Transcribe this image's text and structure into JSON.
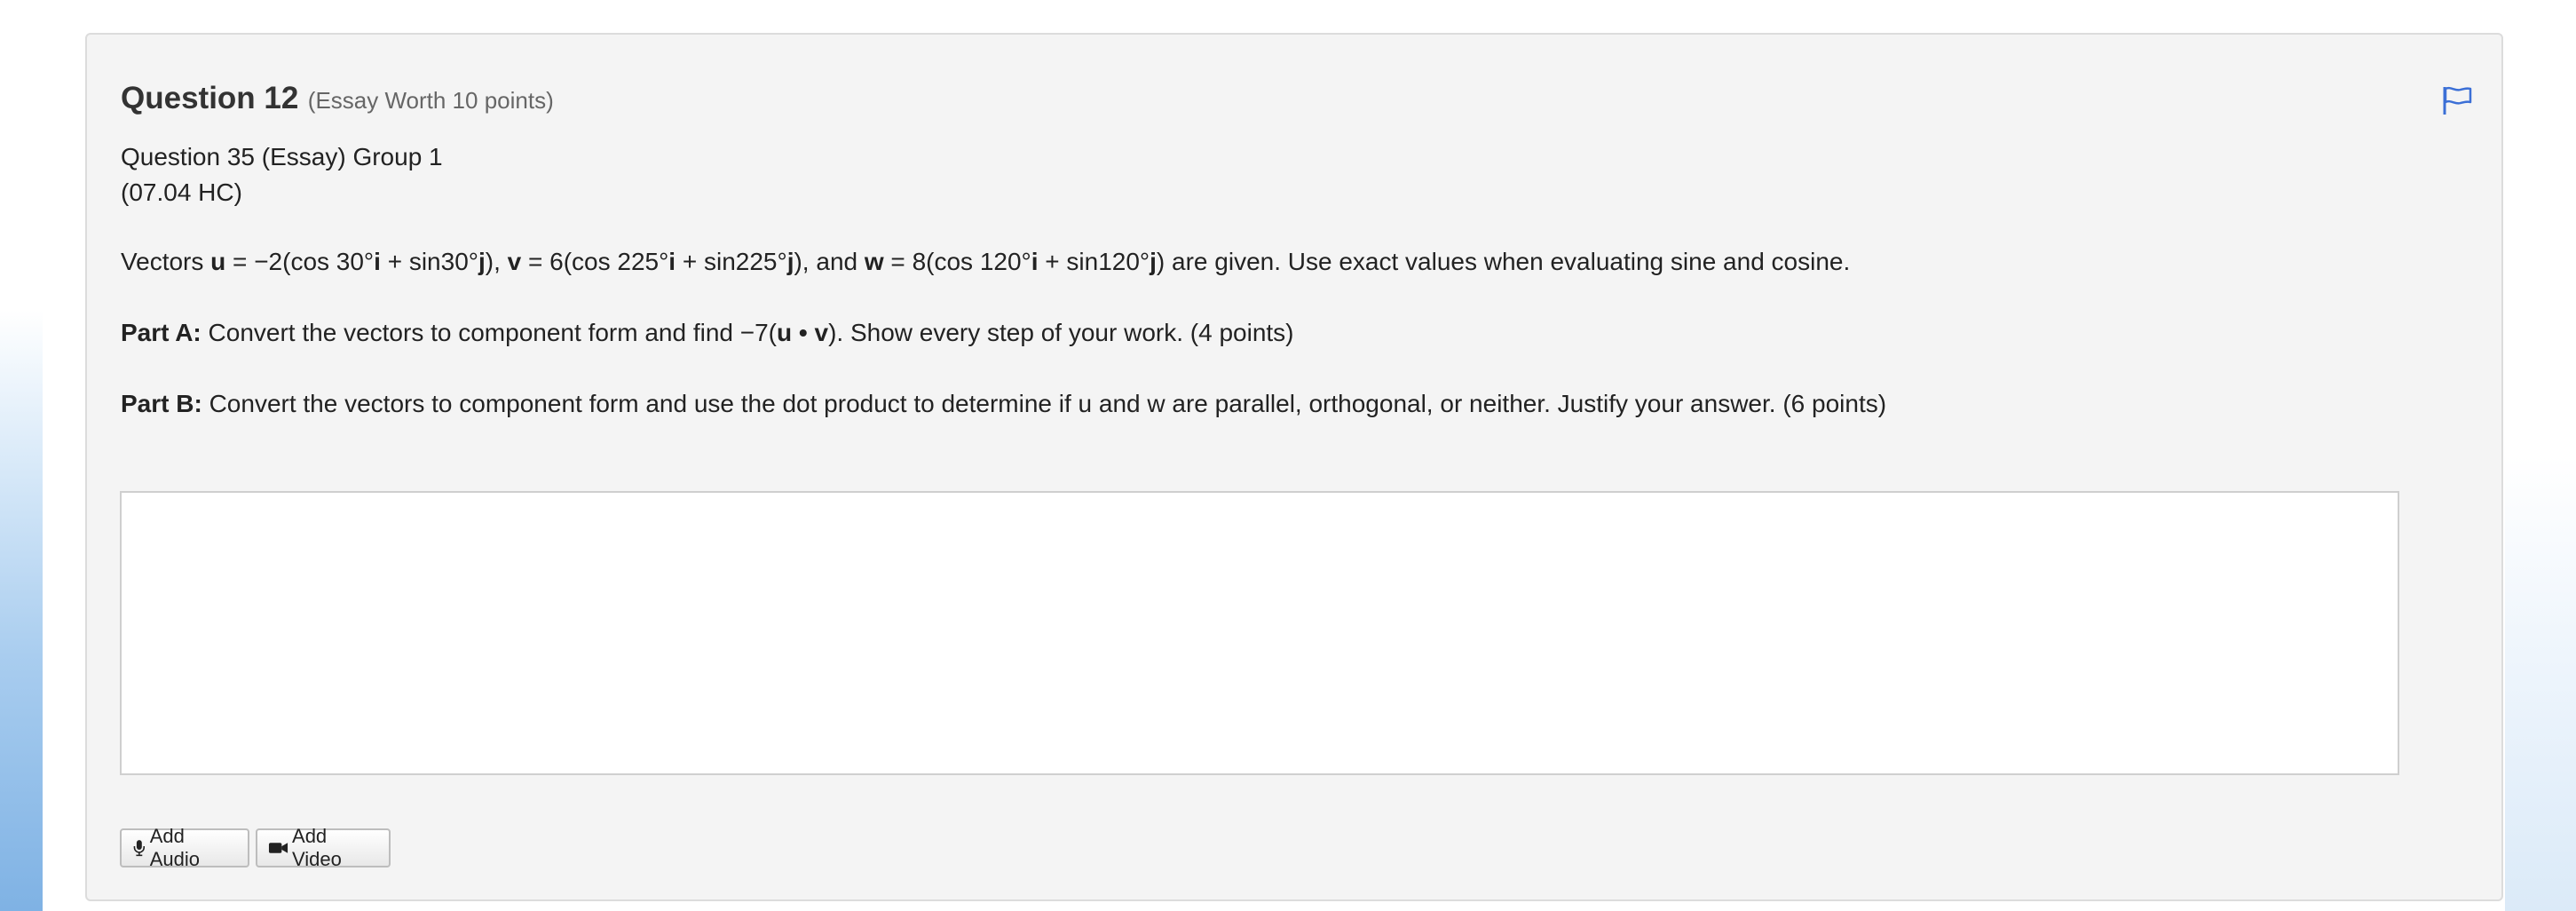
{
  "question": {
    "title": "Question 12",
    "worth": "(Essay Worth 10 points)",
    "group_line": "Question 35 (Essay) Group 1",
    "code_line": "(07.04 HC)",
    "prompt": {
      "p1": "Vectors ",
      "u": "u",
      "p2": " = −2(cos 30°",
      "i1": "i",
      "p3": " + sin30°",
      "j1": "j",
      "p4": "), ",
      "v": "v",
      "p5": " = 6(cos 225°",
      "i2": "i",
      "p6": " + sin225°",
      "j2": "j",
      "p7": "), and ",
      "w": "w",
      "p8": " = 8(cos 120°",
      "i3": "i",
      "p9": " + sin120°",
      "j3": "j",
      "p10": ") are given. Use exact values when evaluating sine and cosine."
    },
    "part_a": {
      "label": "Part A:",
      "t1": " Convert the vectors to component form and find −7(",
      "u": "u",
      "dot": " • ",
      "v": "v",
      "t2": "). Show every step of your work. (4 points)"
    },
    "part_b": {
      "label": "Part B:",
      "text": " Convert the vectors to component form and use the dot product to determine if u and w are parallel, orthogonal, or neither. Justify your answer. (6 points)"
    }
  },
  "answer": {
    "value": "",
    "placeholder": ""
  },
  "buttons": {
    "add_audio": "Add Audio",
    "add_video": "Add Video"
  },
  "icons": {
    "flag": "flag-icon",
    "microphone": "microphone-icon",
    "video": "video-camera-icon"
  },
  "colors": {
    "flag": "#3b6fd6",
    "card_bg": "#f4f4f4"
  }
}
